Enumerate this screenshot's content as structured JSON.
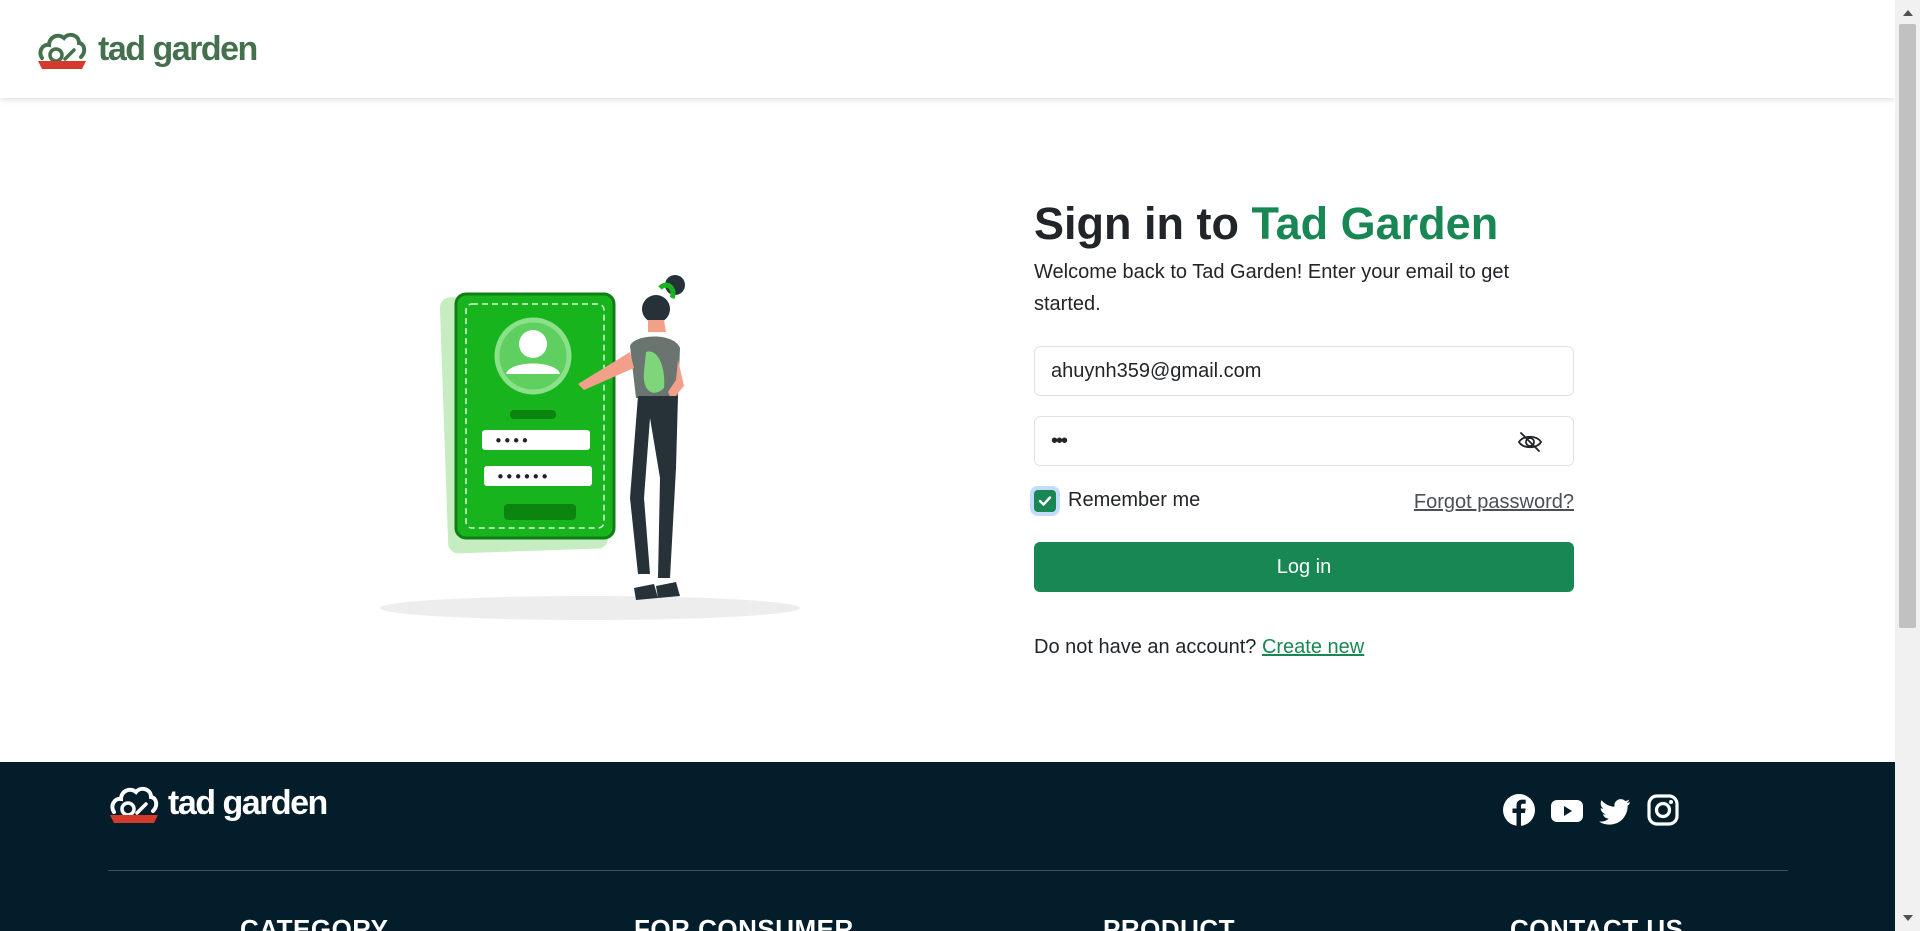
{
  "header": {
    "logo_text": "tad garden"
  },
  "illustration": {
    "icon": "login-illustration",
    "mask_user": "••••",
    "mask_pass": "••••••"
  },
  "form": {
    "title_prefix": "Sign in to ",
    "title_brand": "Tad Garden",
    "subtitle": "Welcome back to Tad Garden! Enter your email to get started.",
    "email_value": "ahuynh359@gmail.com",
    "password_mask": "•••",
    "remember_label": "Remember me",
    "remember_checked": true,
    "forgot_label": "Forgot password?",
    "login_label": "Log in",
    "signup_prompt": "Do not have an account? ",
    "signup_link": "Create new"
  },
  "footer": {
    "logo_text": "tad garden",
    "socials": [
      "facebook-icon",
      "youtube-icon",
      "twitter-icon",
      "instagram-icon"
    ],
    "columns": [
      "CATEGORY",
      "FOR CONSUMER",
      "PRODUCT",
      "CONTACT US"
    ]
  },
  "colors": {
    "brand": "#198754",
    "footer_bg": "#031d2b",
    "logo_green": "#45704d",
    "logo_red": "#d33a2c"
  }
}
